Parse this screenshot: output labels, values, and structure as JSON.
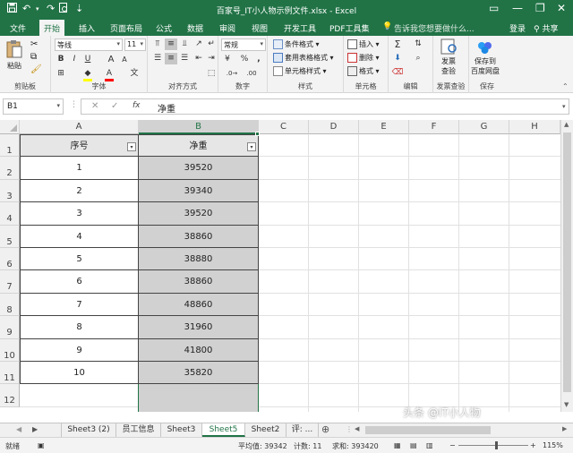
{
  "titlebar": {
    "title": "百家号_IT小人物示例文件.xlsx - Excel",
    "save_icon": "save-icon",
    "undo": "↶",
    "redo": "↷",
    "preview_icon": "print-preview-icon",
    "customize": "⇣",
    "ribbon_display": "▭",
    "minimize": "—",
    "restore": "❐",
    "close": "✕"
  },
  "tabs": [
    "文件",
    "开始",
    "插入",
    "页面布局",
    "公式",
    "数据",
    "审阅",
    "视图",
    "开发工具",
    "PDF工具集"
  ],
  "active_tab": "开始",
  "tell_me": "告诉我您想要做什么...",
  "login": "登录",
  "share": "共享",
  "ribbon": {
    "clipboard": {
      "paste": "粘贴",
      "label": "剪贴板"
    },
    "font": {
      "name": "等线",
      "size": "11",
      "label": "字体",
      "bold": "B",
      "italic": "I",
      "underline": "U",
      "grow": "A",
      "shrink": "A",
      "color_letter": "A",
      "phonetic": "文",
      "fill_color": "#ffff00",
      "font_color": "#ff0000"
    },
    "alignment": {
      "label": "对齐方式"
    },
    "number": {
      "format": "常规",
      "label": "数字",
      "percent": "%",
      "comma": ","
    },
    "styles": {
      "conditional": "条件格式",
      "table": "套用表格格式",
      "cell_styles": "单元格样式",
      "label": "样式"
    },
    "cells": {
      "insert": "插入",
      "delete": "删除",
      "format": "格式",
      "label": "单元格"
    },
    "editing": {
      "sum": "Σ",
      "label": "编辑"
    },
    "invoice": {
      "btn": [
        "发票",
        "查验"
      ],
      "label": "发票查验"
    },
    "save": {
      "btn": [
        "保存到",
        "百度网盘"
      ],
      "label": "保存"
    }
  },
  "formula": {
    "cell_ref": "B1",
    "cancel": "✕",
    "enter": "✓",
    "fx": "fx",
    "content": "净重"
  },
  "columns": [
    "A",
    "B",
    "C",
    "D",
    "E",
    "F",
    "G",
    "H"
  ],
  "rows": [
    "1",
    "2",
    "3",
    "4",
    "5",
    "6",
    "7",
    "8",
    "9",
    "10",
    "11",
    "12"
  ],
  "table": {
    "headers": [
      "序号",
      "净重"
    ],
    "data": [
      [
        "1",
        "39520"
      ],
      [
        "2",
        "39340"
      ],
      [
        "3",
        "39520"
      ],
      [
        "4",
        "38860"
      ],
      [
        "5",
        "38880"
      ],
      [
        "6",
        "38860"
      ],
      [
        "7",
        "48860"
      ],
      [
        "8",
        "31960"
      ],
      [
        "9",
        "41800"
      ],
      [
        "10",
        "35820"
      ]
    ]
  },
  "sheets": [
    "Sheet3 (2)",
    "员工信息",
    "Sheet3",
    "Sheet5",
    "Sheet2",
    "评: ..."
  ],
  "active_sheet": "Sheet5",
  "status": {
    "ready": "就绪",
    "average": "平均值: 39342",
    "count": "计数: 11",
    "sum": "求和: 393420",
    "zoom": "115%",
    "watermark": "头条 @IT小人物"
  }
}
